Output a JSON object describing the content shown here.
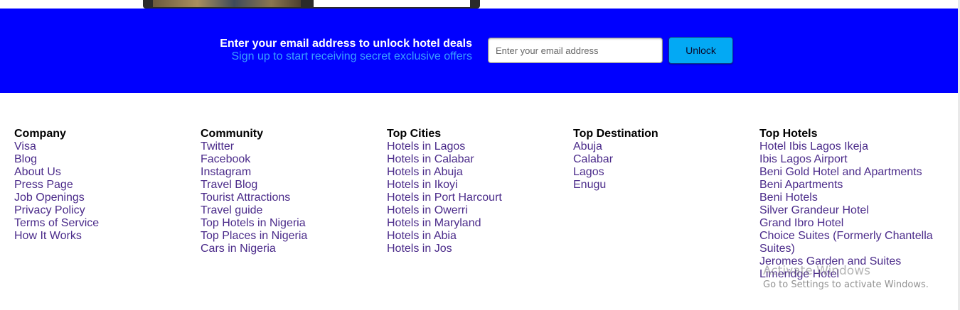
{
  "newsletter": {
    "title": "Enter your email address to unlock hotel deals",
    "subtitle": "Sign up to start receiving secret exclusive offers",
    "email_placeholder": "Enter your email address",
    "email_value": "",
    "unlock_label": "Unlock",
    "band_color": "#0000ff",
    "button_color": "#03a9f4"
  },
  "footer": {
    "company": {
      "heading": "Company",
      "links": [
        "Visa",
        "Blog",
        "About Us",
        "Press Page",
        "Job Openings",
        "Privacy Policy",
        "Terms of Service",
        "How It Works"
      ]
    },
    "community": {
      "heading": "Community",
      "links": [
        "Twitter",
        "Facebook",
        "Instagram",
        "Travel Blog",
        "Tourist Attractions",
        "Travel guide",
        "Top Hotels in Nigeria",
        "Top Places in Nigeria",
        "Cars in Nigeria"
      ]
    },
    "top_cities": {
      "heading": "Top Cities",
      "links": [
        "Hotels in Lagos",
        "Hotels in Calabar",
        "Hotels in Abuja",
        "Hotels in Ikoyi",
        "Hotels in Port Harcourt",
        "Hotels in Owerri",
        "Hotels in Maryland",
        "Hotels in Abia",
        "Hotels in Jos"
      ]
    },
    "top_destination": {
      "heading": "Top Destination",
      "links": [
        "Abuja",
        "Calabar",
        "Lagos",
        "Enugu"
      ]
    },
    "top_hotels": {
      "heading": "Top Hotels",
      "links": [
        "Hotel Ibis Lagos Ikeja",
        "Ibis Lagos Airport",
        "Beni Gold Hotel and Apartments",
        "Beni Apartments",
        "Beni Hotels",
        "Silver Grandeur Hotel",
        "Grand Ibro Hotel",
        "Choice Suites (Formerly Chantella",
        "Suites)",
        "Jeromes Garden and Suites",
        "Limeridge Hotel"
      ]
    },
    "link_color": "#4b2b8a"
  },
  "watermark": {
    "title": "Activate Windows",
    "subtitle": "Go to Settings to activate Windows."
  }
}
